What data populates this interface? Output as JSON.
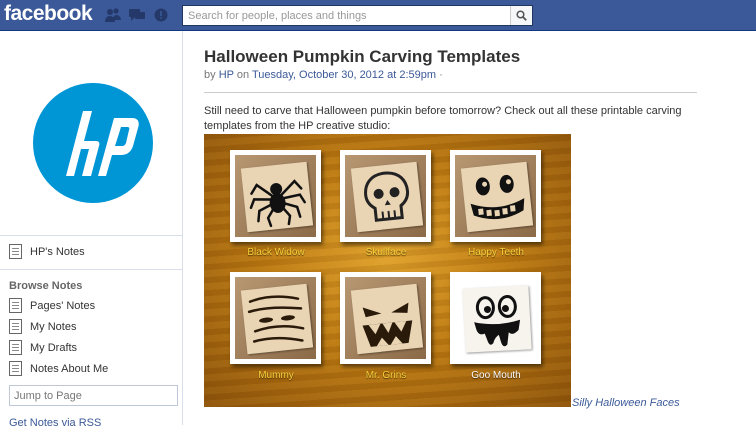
{
  "header": {
    "logo_text": "facebook",
    "search_placeholder": "Search for people, places and things",
    "brand_color": "#3b5998"
  },
  "sidebar": {
    "page_notes_label": "HP's Notes",
    "browse_heading": "Browse Notes",
    "items": [
      {
        "label": "Pages' Notes",
        "icon": "note-icon"
      },
      {
        "label": "My Notes",
        "icon": "note-icon"
      },
      {
        "label": "My Drafts",
        "icon": "note-icon"
      },
      {
        "label": "Notes About Me",
        "icon": "note-icon"
      }
    ],
    "jump_placeholder": "Jump to Page",
    "rss_link": "Get Notes via RSS"
  },
  "note": {
    "title": "Halloween Pumpkin Carving Templates",
    "byline_prefix": "by",
    "author": "HP",
    "byline_on": "on",
    "date": "Tuesday, October 30, 2012 at 2:59pm",
    "byline_dot": "·",
    "body": "Still need to carve that Halloween pumpkin before tomorrow? Check out all these printable carving templates from the HP creative studio:",
    "templates": [
      {
        "label": "Black Widow",
        "icon": "spider-icon"
      },
      {
        "label": "Skullface",
        "icon": "skull-icon"
      },
      {
        "label": "Happy Teeth",
        "icon": "happy-teeth-icon"
      },
      {
        "label": "Mummy",
        "icon": "mummy-icon"
      },
      {
        "label": "Mr. Grins",
        "icon": "grin-face-icon"
      },
      {
        "label": "Goo Mouth",
        "icon": "goo-mouth-icon"
      }
    ],
    "caption": "Silly Halloween Faces"
  }
}
